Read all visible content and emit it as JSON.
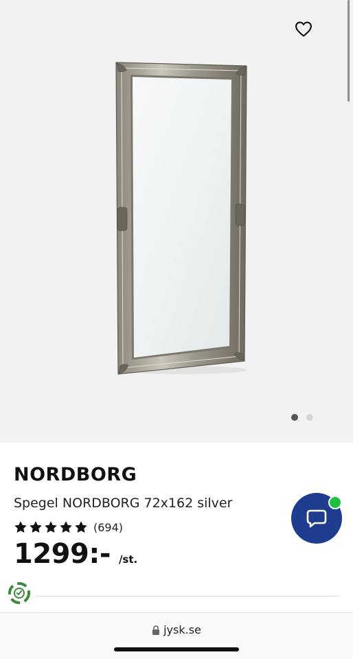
{
  "product": {
    "brand": "NORDBORG",
    "name": "Spegel NORDBORG 72x162 silver",
    "rating": 5,
    "rating_max": 5,
    "review_count": "(694)",
    "price": "1299:-",
    "unit": "/st."
  },
  "gallery": {
    "image_count": 2,
    "active_index": 0
  },
  "browser": {
    "url": "jysk.se"
  },
  "icons": {
    "favorite": "heart-outline-icon",
    "chat": "chat-bubble-icon",
    "eco": "eco-recycle-icon",
    "lock": "lock-icon"
  },
  "colors": {
    "chat_button": "#1e3d8f",
    "online_indicator": "#1fbf3f",
    "star": "#111111"
  }
}
